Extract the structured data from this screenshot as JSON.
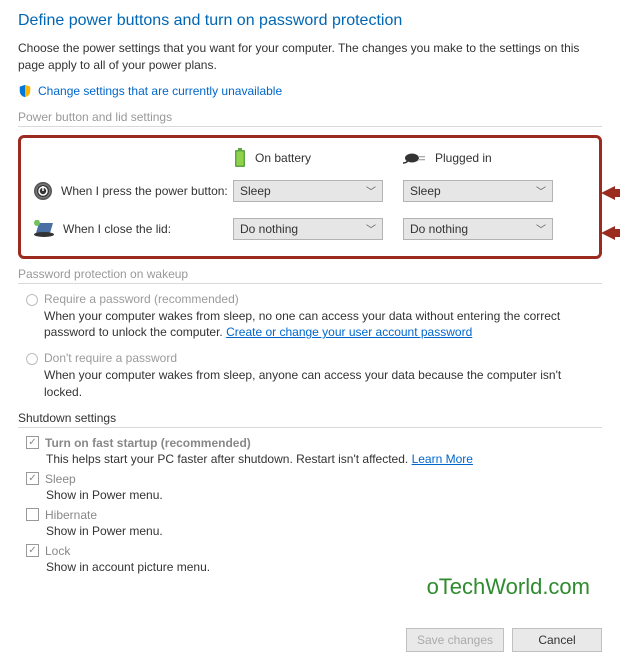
{
  "header": {
    "title": "Define power buttons and turn on password protection",
    "intro": "Choose the power settings that you want for your computer. The changes you make to the settings on this page apply to all of your power plans.",
    "admin_link": "Change settings that are currently unavailable"
  },
  "power_button_group": {
    "label": "Power button and lid settings",
    "column_battery": "On battery",
    "column_plugged": "Plugged in",
    "row_power_label": "When I press the power button:",
    "row_power_battery_value": "Sleep",
    "row_power_plugged_value": "Sleep",
    "row_lid_label": "When I close the lid:",
    "row_lid_battery_value": "Do nothing",
    "row_lid_plugged_value": "Do nothing"
  },
  "password_group": {
    "label": "Password protection on wakeup",
    "opt1_label": "Require a password (recommended)",
    "opt1_desc_a": "When your computer wakes from sleep, no one can access your data without entering the correct password to unlock the computer. ",
    "opt1_link": "Create or change your user account password",
    "opt2_label": "Don't require a password",
    "opt2_desc": "When your computer wakes from sleep, anyone can access your data because the computer isn't locked."
  },
  "shutdown_group": {
    "label": "Shutdown settings",
    "fast_label": "Turn on fast startup (recommended)",
    "fast_desc": "This helps start your PC faster after shutdown. Restart isn't affected. ",
    "fast_link": "Learn More",
    "sleep_label": "Sleep",
    "sleep_desc": "Show in Power menu.",
    "hibernate_label": "Hibernate",
    "hibernate_desc": "Show in Power menu.",
    "lock_label": "Lock",
    "lock_desc": "Show in account picture menu."
  },
  "footer": {
    "save": "Save changes",
    "cancel": "Cancel"
  },
  "watermark": "oTechWorld.com"
}
